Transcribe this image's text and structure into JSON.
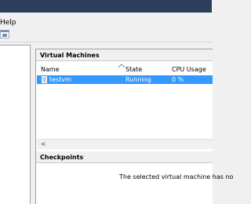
{
  "menu": {
    "help_label": "Help"
  },
  "toolbar": {
    "icon": "console-window-icon"
  },
  "virtual_machines": {
    "section_title": "Virtual Machines",
    "columns": [
      "Name",
      "State",
      "CPU Usage"
    ],
    "rows": [
      {
        "name": "testvm",
        "state": "Running",
        "cpu": "0 %",
        "selected": true
      }
    ],
    "scroll_left_glyph": "<"
  },
  "checkpoints": {
    "section_title": "Checkpoints",
    "message": "The selected virtual machine has no"
  },
  "colors": {
    "selection": "#3399ff",
    "titlebar": "#2b3f5c"
  }
}
